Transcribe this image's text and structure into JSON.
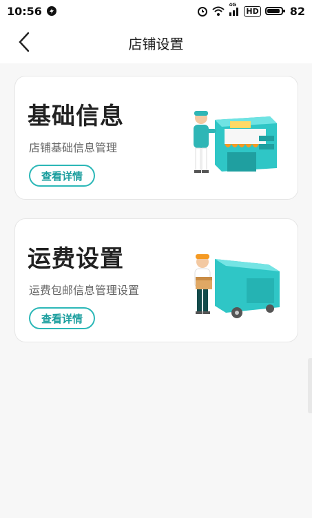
{
  "status_bar": {
    "time": "10:56",
    "network": "4G",
    "hd": "HD",
    "battery": "82"
  },
  "nav": {
    "title": "店铺设置"
  },
  "cards": [
    {
      "title": "基础信息",
      "subtitle": "店铺基础信息管理",
      "button": "查看详情",
      "illustration": "shop-staff-illustration"
    },
    {
      "title": "运费设置",
      "subtitle": "运费包邮信息管理设置",
      "button": "查看详情",
      "illustration": "delivery-truck-illustration"
    }
  ],
  "colors": {
    "accent": "#2bb7b7",
    "teal_dark": "#1b9e9e",
    "orange": "#f59a23"
  }
}
